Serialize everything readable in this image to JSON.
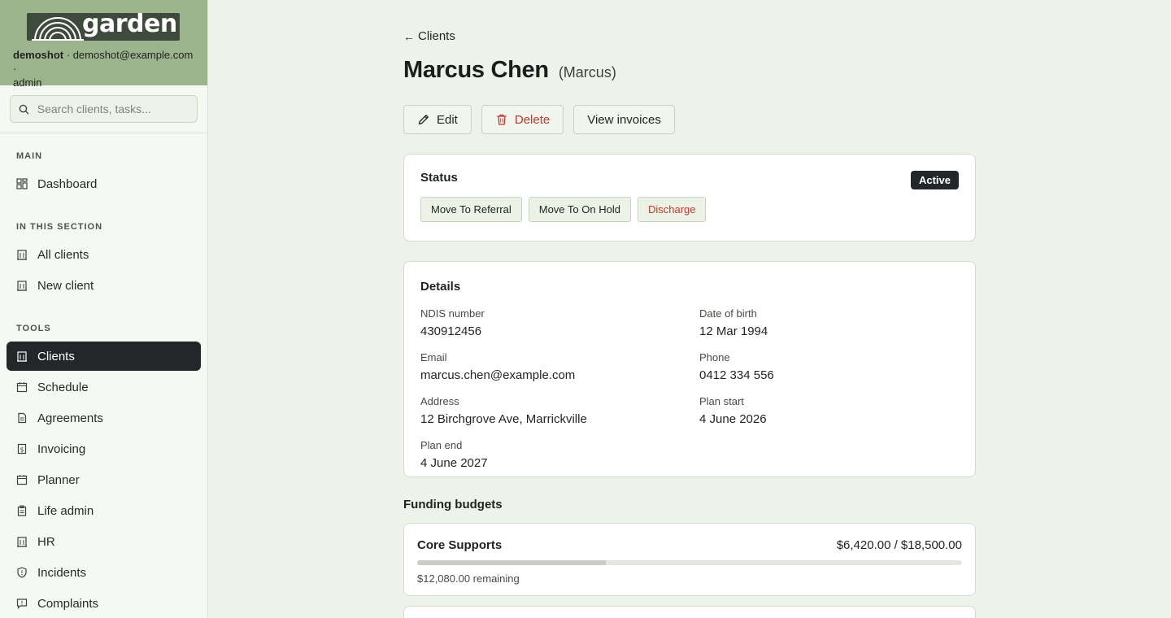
{
  "brand": {
    "name": "garden",
    "user": "demoshot",
    "email": "demoshot@example.com",
    "role": "admin",
    "separator": " · "
  },
  "search": {
    "placeholder": "Search clients, tasks..."
  },
  "nav": {
    "sections": [
      {
        "title": "MAIN",
        "items": [
          {
            "label": "Dashboard",
            "icon": "dashboard-icon"
          }
        ]
      },
      {
        "title": "IN THIS SECTION",
        "items": [
          {
            "label": "All clients",
            "icon": "building-icon"
          },
          {
            "label": "New client",
            "icon": "building-icon"
          }
        ]
      },
      {
        "title": "TOOLS",
        "items": [
          {
            "label": "Clients",
            "icon": "building-icon",
            "active": true
          },
          {
            "label": "Schedule",
            "icon": "calendar-icon"
          },
          {
            "label": "Agreements",
            "icon": "document-icon"
          },
          {
            "label": "Invoicing",
            "icon": "invoice-icon"
          },
          {
            "label": "Planner",
            "icon": "calendar-icon"
          },
          {
            "label": "Life admin",
            "icon": "clipboard-icon"
          },
          {
            "label": "HR",
            "icon": "building-icon"
          },
          {
            "label": "Incidents",
            "icon": "shield-icon"
          },
          {
            "label": "Complaints",
            "icon": "message-icon"
          }
        ]
      }
    ]
  },
  "page": {
    "back_label": "Clients",
    "title": "Marcus Chen",
    "nickname": "(Marcus)",
    "actions": {
      "edit": "Edit",
      "delete": "Delete",
      "invoices": "View invoices"
    }
  },
  "status": {
    "title": "Status",
    "badge": "Active",
    "buttons": [
      "Move To Referral",
      "Move To On Hold",
      "Discharge"
    ]
  },
  "details": {
    "title": "Details",
    "fields": [
      {
        "label": "NDIS number",
        "value": "430912456"
      },
      {
        "label": "Date of birth",
        "value": "12 Mar 1994"
      },
      {
        "label": "Email",
        "value": "marcus.chen@example.com"
      },
      {
        "label": "Phone",
        "value": "0412 334 556"
      },
      {
        "label": "Address",
        "value": "12 Birchgrove Ave, Marrickville"
      },
      {
        "label": "Plan start",
        "value": "4 June 2026"
      },
      {
        "label": "Plan end",
        "value": "4 June 2027"
      }
    ]
  },
  "funding": {
    "heading": "Funding budgets",
    "budgets": [
      {
        "name": "Core Supports",
        "amount": "$6,420.00 / $18,500.00",
        "remaining": "$12,080.00 remaining",
        "used_fraction": 0.347
      }
    ]
  },
  "colors": {
    "accent_dark": "#23272a",
    "brand_green": "#9cb48d",
    "danger": "#c0392b",
    "page_bg": "#edf3e8"
  }
}
